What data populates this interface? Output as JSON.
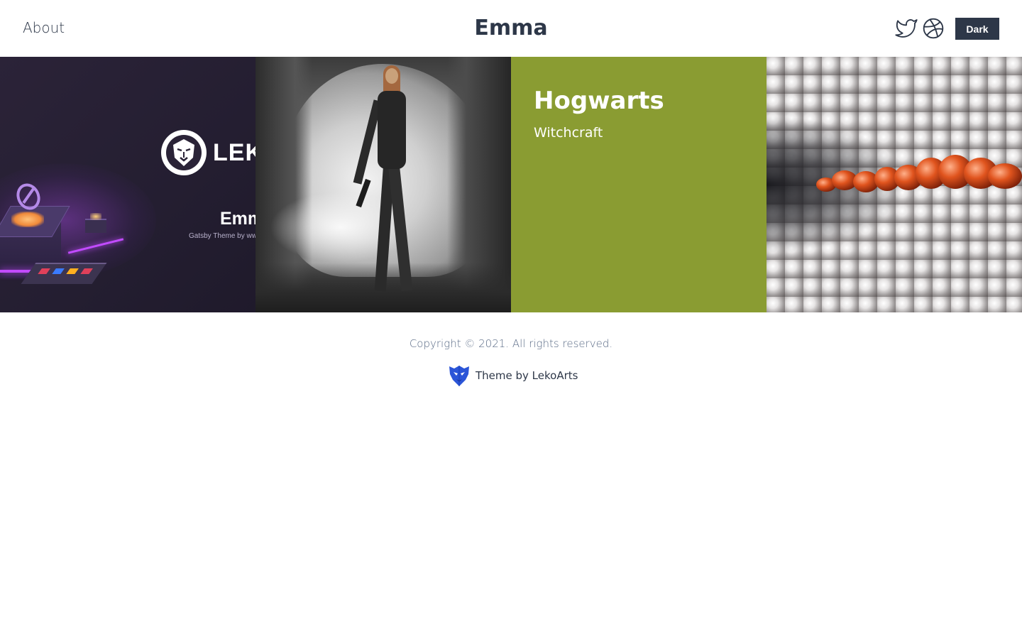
{
  "header": {
    "nav_about": "About",
    "site_title": "Emma",
    "social": [
      {
        "icon": "twitter-icon"
      },
      {
        "icon": "dribbble-icon"
      }
    ],
    "theme_toggle": "Dark"
  },
  "projects": [
    {
      "cover_logo_text": "LEK",
      "cover_title": "Emm",
      "cover_subtitle": "Gatsby Theme by ww"
    },
    {
      "image": "woman-in-cave-photo"
    },
    {
      "title": "Hogwarts",
      "subtitle": "Witchcraft",
      "color": "#8a9c32"
    },
    {
      "image": "spheres-chain-render"
    }
  ],
  "footer": {
    "copyright": "Copyright © 2021. All rights reserved.",
    "credit": "Theme by LekoArts",
    "credit_icon": "lekoarts-logo-icon"
  },
  "colors": {
    "primary_text": "#2d3748",
    "toggle_bg": "#2d3748",
    "muted_text": "#5a6b86",
    "card_green": "#8a9c32"
  }
}
